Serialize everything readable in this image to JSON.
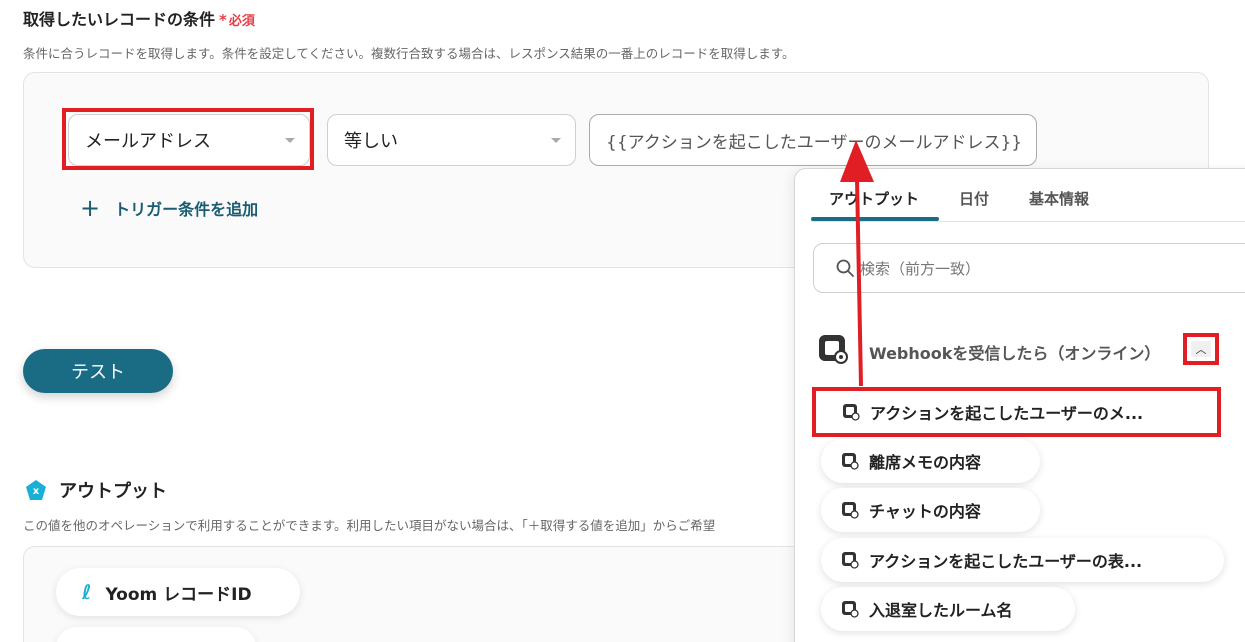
{
  "condition": {
    "title": "取得したいレコードの条件",
    "required_mark": "*",
    "required_label": "必須",
    "description": "条件に合うレコードを取得します。条件を設定してください。複数行合致する場合は、レスポンス結果の一番上のレコードを取得します。",
    "field_select": "メールアドレス",
    "operator_select": "等しい",
    "value": "{{アクションを起こしたユーザーのメールアドレス}}",
    "add_trigger_label": "トリガー条件を追加"
  },
  "test_button": "テスト",
  "output": {
    "title": "アウトプット",
    "description": "この値を他のオペレーションで利用することができます。利用したい項目がない場合は、「＋取得する値を追加」からご希望",
    "chips": [
      "Yoom レコードID"
    ]
  },
  "popup": {
    "tabs": [
      {
        "label": "アウトプット",
        "active": true
      },
      {
        "label": "日付",
        "active": false
      },
      {
        "label": "基本情報",
        "active": false
      }
    ],
    "search_placeholder": "検索（前方一致）",
    "group_title": "Webhookを受信したら（オンライン）",
    "items": [
      "アクションを起こしたユーザーのメ...",
      "離席メモの内容",
      "チャットの内容",
      "アクションを起こしたユーザーの表...",
      "入退室したルーム名"
    ]
  },
  "colors": {
    "accent": "#1a6b84",
    "highlight": "#e01e24",
    "required": "#e5404a"
  }
}
